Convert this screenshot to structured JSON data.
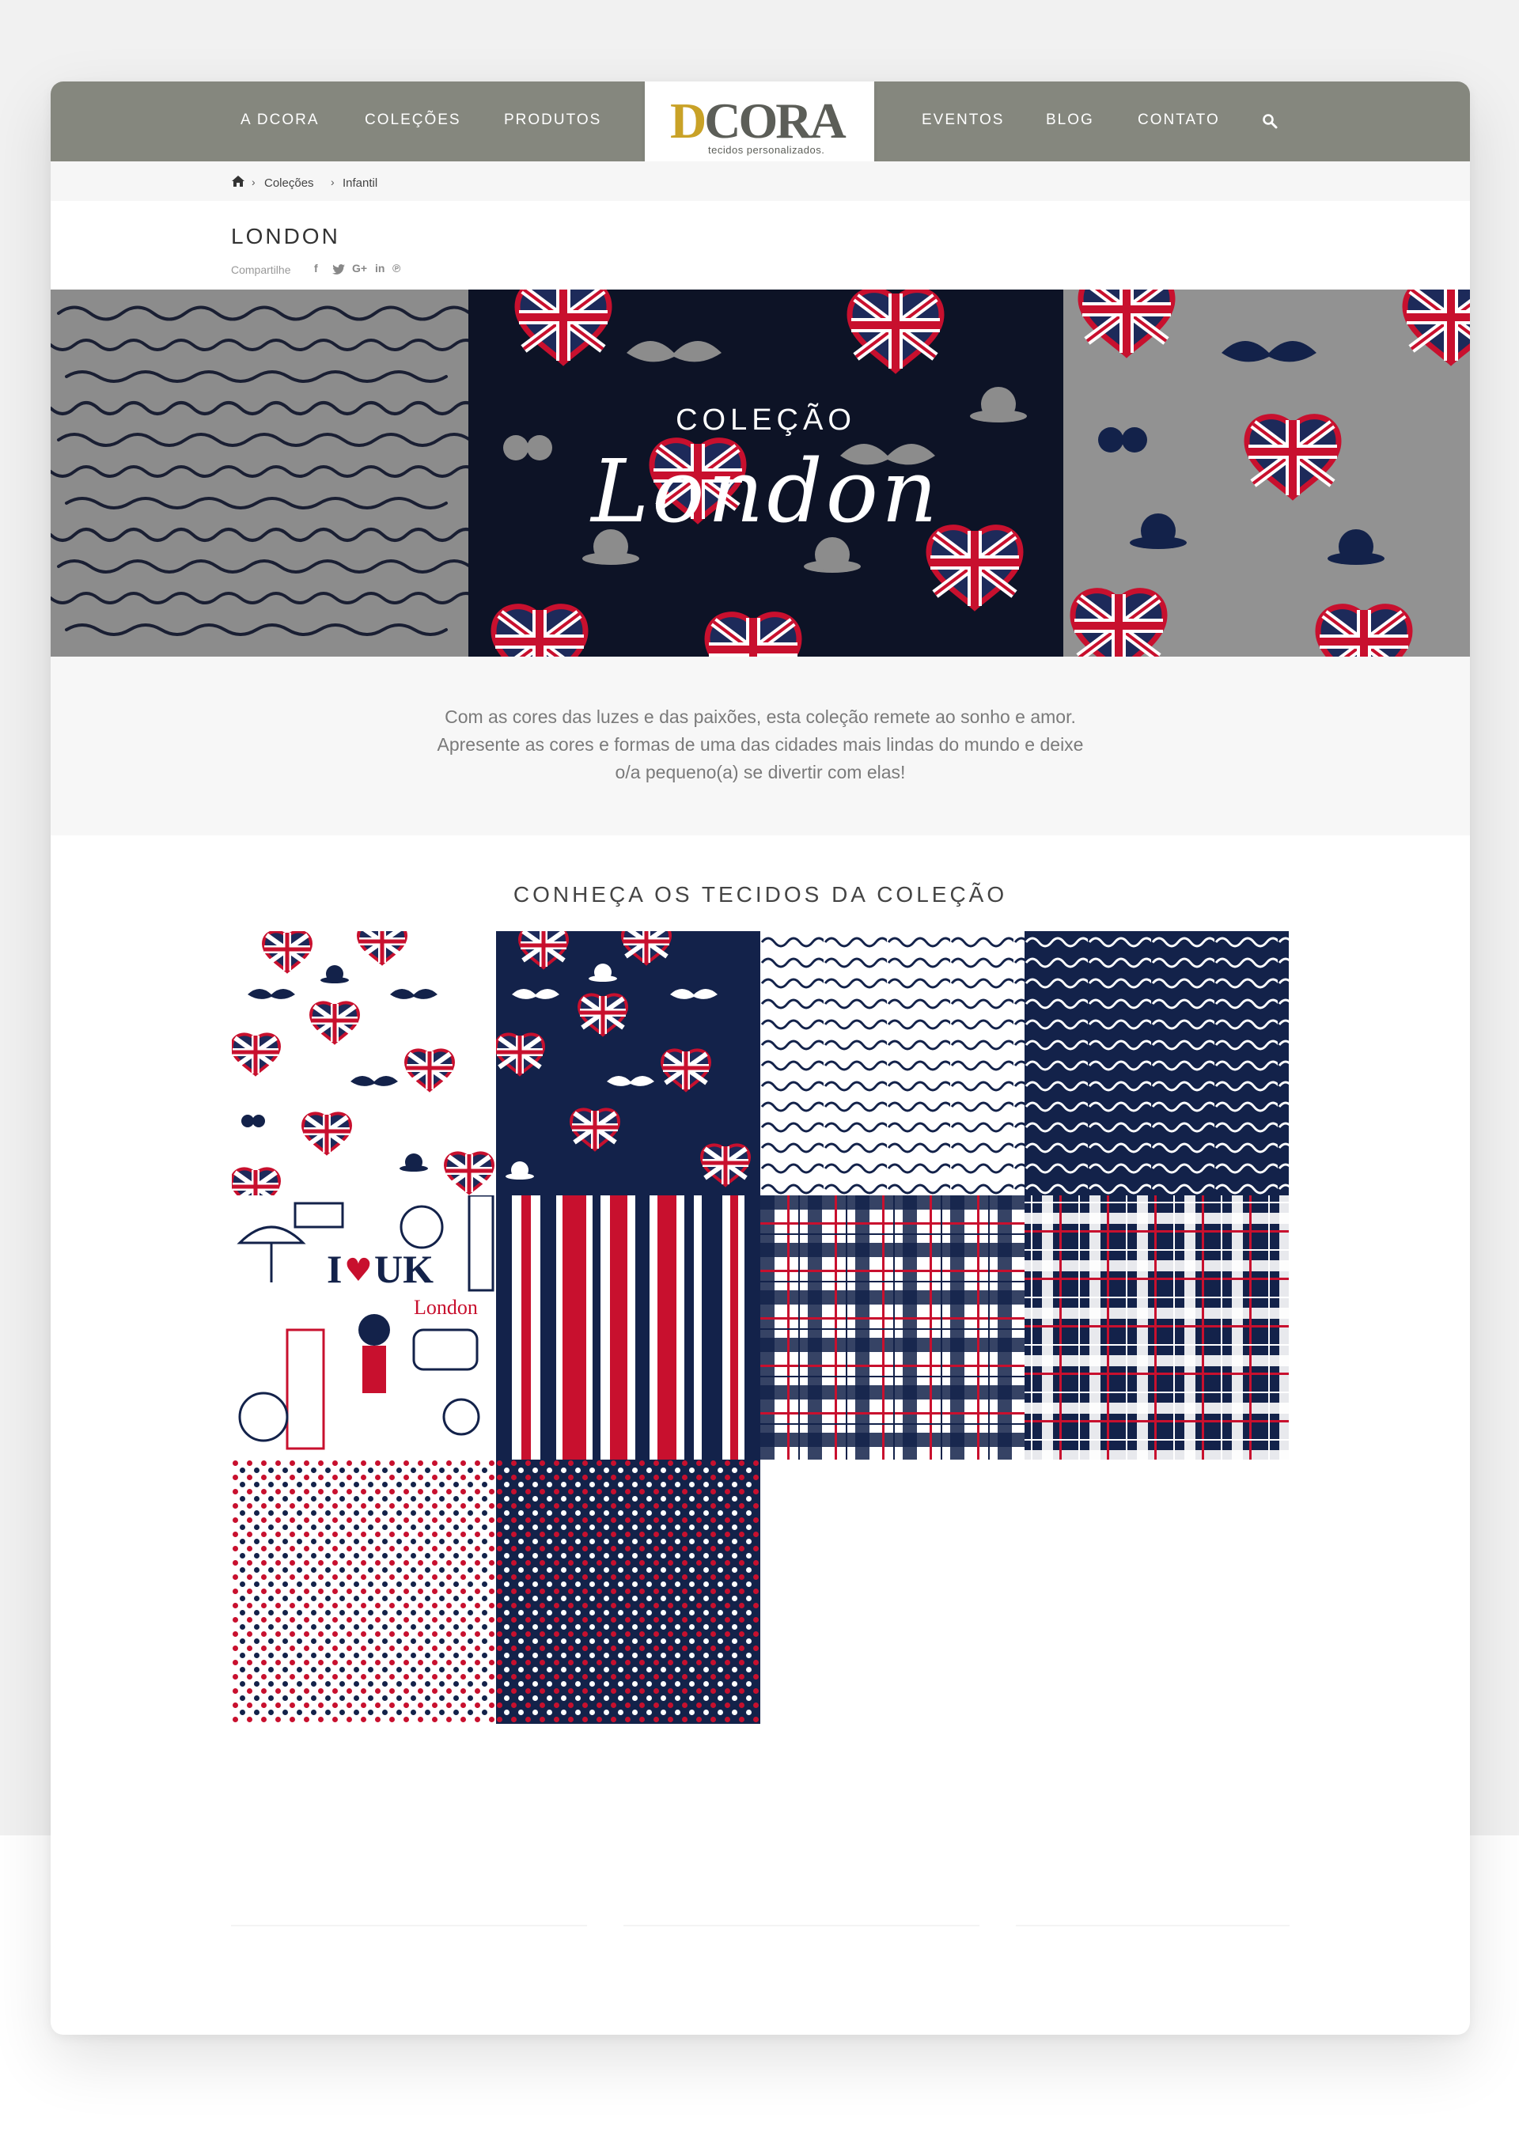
{
  "nav": {
    "items_left": [
      "A DCORA",
      "COLEÇÕES",
      "PRODUTOS"
    ],
    "items_right": [
      "EVENTOS",
      "BLOG",
      "CONTATO"
    ],
    "logo": {
      "text": "DCORA",
      "tagline": "tecidos personalizados."
    },
    "search_icon": "search-icon"
  },
  "breadcrumb": {
    "home_icon": "home-icon",
    "items": [
      "Coleções",
      "Infantil"
    ]
  },
  "page": {
    "title": "LONDON",
    "share_label": "Compartilhe",
    "social_icons": [
      "facebook-icon",
      "twitter-icon",
      "google-plus-icon",
      "linkedin-icon",
      "pinterest-icon"
    ]
  },
  "hero": {
    "subtitle": "COLEÇÃO",
    "title": "London"
  },
  "description": {
    "lines": [
      "Com as cores das luzes e das paixões, esta coleção remete ao sonho e amor.",
      "Apresente as cores e formas de uma das cidades mais lindas do mundo e deixe",
      "o/a pequeno(a) se divertir com elas!"
    ]
  },
  "fabrics": {
    "title": "CONHEÇA OS TECIDOS DA COLEÇÃO",
    "swatch_text": {
      "i_love": "I",
      "uk": "UK",
      "london": "London"
    },
    "colors": {
      "navy": "#13224a",
      "red": "#c8102e",
      "white": "#ffffff",
      "gray": "#8c8c8c"
    }
  }
}
